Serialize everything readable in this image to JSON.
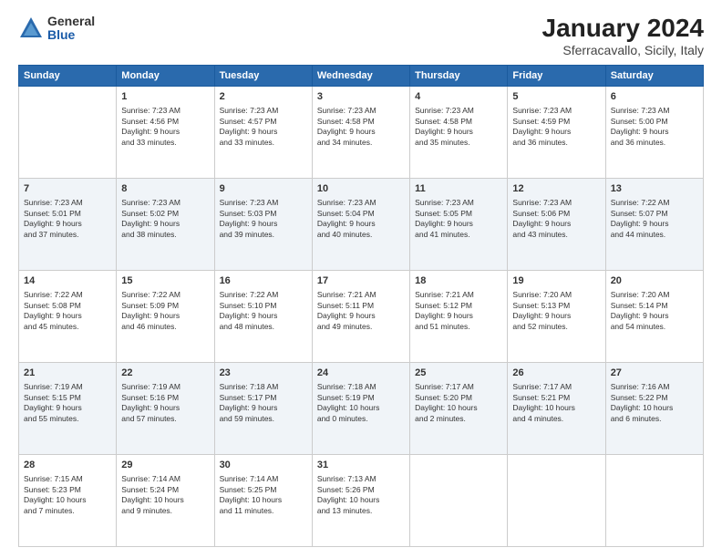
{
  "logo": {
    "general": "General",
    "blue": "Blue"
  },
  "title": "January 2024",
  "subtitle": "Sferracavallo, Sicily, Italy",
  "days_of_week": [
    "Sunday",
    "Monday",
    "Tuesday",
    "Wednesday",
    "Thursday",
    "Friday",
    "Saturday"
  ],
  "weeks": [
    [
      {
        "day": "",
        "info": ""
      },
      {
        "day": "1",
        "info": "Sunrise: 7:23 AM\nSunset: 4:56 PM\nDaylight: 9 hours\nand 33 minutes."
      },
      {
        "day": "2",
        "info": "Sunrise: 7:23 AM\nSunset: 4:57 PM\nDaylight: 9 hours\nand 33 minutes."
      },
      {
        "day": "3",
        "info": "Sunrise: 7:23 AM\nSunset: 4:58 PM\nDaylight: 9 hours\nand 34 minutes."
      },
      {
        "day": "4",
        "info": "Sunrise: 7:23 AM\nSunset: 4:58 PM\nDaylight: 9 hours\nand 35 minutes."
      },
      {
        "day": "5",
        "info": "Sunrise: 7:23 AM\nSunset: 4:59 PM\nDaylight: 9 hours\nand 36 minutes."
      },
      {
        "day": "6",
        "info": "Sunrise: 7:23 AM\nSunset: 5:00 PM\nDaylight: 9 hours\nand 36 minutes."
      }
    ],
    [
      {
        "day": "7",
        "info": "Sunrise: 7:23 AM\nSunset: 5:01 PM\nDaylight: 9 hours\nand 37 minutes."
      },
      {
        "day": "8",
        "info": "Sunrise: 7:23 AM\nSunset: 5:02 PM\nDaylight: 9 hours\nand 38 minutes."
      },
      {
        "day": "9",
        "info": "Sunrise: 7:23 AM\nSunset: 5:03 PM\nDaylight: 9 hours\nand 39 minutes."
      },
      {
        "day": "10",
        "info": "Sunrise: 7:23 AM\nSunset: 5:04 PM\nDaylight: 9 hours\nand 40 minutes."
      },
      {
        "day": "11",
        "info": "Sunrise: 7:23 AM\nSunset: 5:05 PM\nDaylight: 9 hours\nand 41 minutes."
      },
      {
        "day": "12",
        "info": "Sunrise: 7:23 AM\nSunset: 5:06 PM\nDaylight: 9 hours\nand 43 minutes."
      },
      {
        "day": "13",
        "info": "Sunrise: 7:22 AM\nSunset: 5:07 PM\nDaylight: 9 hours\nand 44 minutes."
      }
    ],
    [
      {
        "day": "14",
        "info": "Sunrise: 7:22 AM\nSunset: 5:08 PM\nDaylight: 9 hours\nand 45 minutes."
      },
      {
        "day": "15",
        "info": "Sunrise: 7:22 AM\nSunset: 5:09 PM\nDaylight: 9 hours\nand 46 minutes."
      },
      {
        "day": "16",
        "info": "Sunrise: 7:22 AM\nSunset: 5:10 PM\nDaylight: 9 hours\nand 48 minutes."
      },
      {
        "day": "17",
        "info": "Sunrise: 7:21 AM\nSunset: 5:11 PM\nDaylight: 9 hours\nand 49 minutes."
      },
      {
        "day": "18",
        "info": "Sunrise: 7:21 AM\nSunset: 5:12 PM\nDaylight: 9 hours\nand 51 minutes."
      },
      {
        "day": "19",
        "info": "Sunrise: 7:20 AM\nSunset: 5:13 PM\nDaylight: 9 hours\nand 52 minutes."
      },
      {
        "day": "20",
        "info": "Sunrise: 7:20 AM\nSunset: 5:14 PM\nDaylight: 9 hours\nand 54 minutes."
      }
    ],
    [
      {
        "day": "21",
        "info": "Sunrise: 7:19 AM\nSunset: 5:15 PM\nDaylight: 9 hours\nand 55 minutes."
      },
      {
        "day": "22",
        "info": "Sunrise: 7:19 AM\nSunset: 5:16 PM\nDaylight: 9 hours\nand 57 minutes."
      },
      {
        "day": "23",
        "info": "Sunrise: 7:18 AM\nSunset: 5:17 PM\nDaylight: 9 hours\nand 59 minutes."
      },
      {
        "day": "24",
        "info": "Sunrise: 7:18 AM\nSunset: 5:19 PM\nDaylight: 10 hours\nand 0 minutes."
      },
      {
        "day": "25",
        "info": "Sunrise: 7:17 AM\nSunset: 5:20 PM\nDaylight: 10 hours\nand 2 minutes."
      },
      {
        "day": "26",
        "info": "Sunrise: 7:17 AM\nSunset: 5:21 PM\nDaylight: 10 hours\nand 4 minutes."
      },
      {
        "day": "27",
        "info": "Sunrise: 7:16 AM\nSunset: 5:22 PM\nDaylight: 10 hours\nand 6 minutes."
      }
    ],
    [
      {
        "day": "28",
        "info": "Sunrise: 7:15 AM\nSunset: 5:23 PM\nDaylight: 10 hours\nand 7 minutes."
      },
      {
        "day": "29",
        "info": "Sunrise: 7:14 AM\nSunset: 5:24 PM\nDaylight: 10 hours\nand 9 minutes."
      },
      {
        "day": "30",
        "info": "Sunrise: 7:14 AM\nSunset: 5:25 PM\nDaylight: 10 hours\nand 11 minutes."
      },
      {
        "day": "31",
        "info": "Sunrise: 7:13 AM\nSunset: 5:26 PM\nDaylight: 10 hours\nand 13 minutes."
      },
      {
        "day": "",
        "info": ""
      },
      {
        "day": "",
        "info": ""
      },
      {
        "day": "",
        "info": ""
      }
    ]
  ]
}
